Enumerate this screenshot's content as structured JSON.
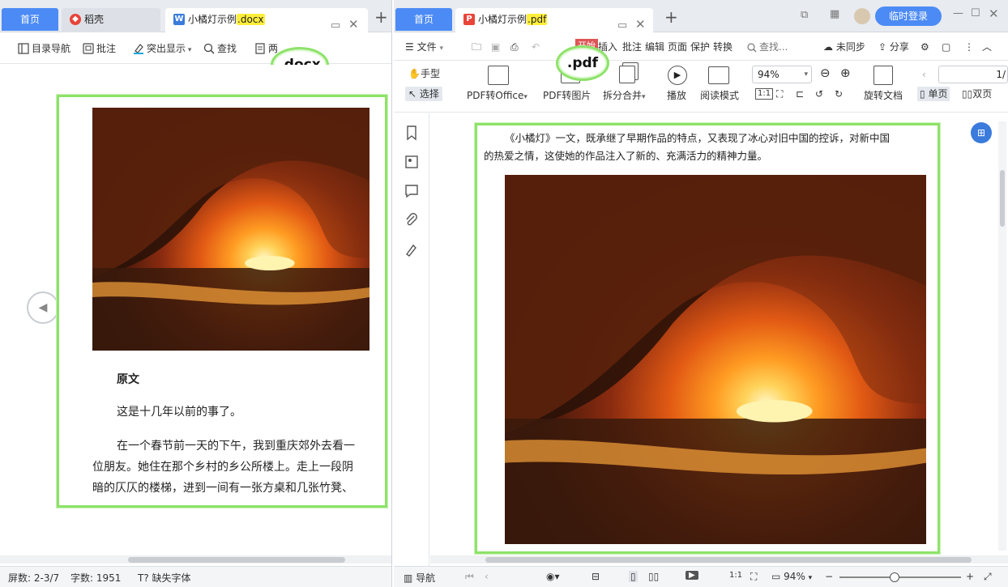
{
  "left": {
    "tabs": {
      "home": "首页",
      "daoke": "稻壳",
      "doc_name": "小橘灯示例",
      "doc_ext": ".docx"
    },
    "toolbar": {
      "nav": "目录导航",
      "comment": "批注",
      "highlight": "突出显示",
      "find": "查找",
      "more": "两"
    },
    "callout": ".docx",
    "doc": {
      "heading": "原文",
      "p1": "这是十几年以前的事了。",
      "p2_l1": "在一个春节前一天的下午，我到重庆郊外去看一",
      "p2_l2": "位朋友。她住在那个乡村的乡公所楼上。走上一段阴",
      "p2_l3": "暗的仄仄的楼梯，进到一间有一张方桌和几张竹凳、"
    },
    "status": {
      "screen": "屏数: 2-3/7",
      "words": "字数: 1951",
      "missing_font": "缺失字体"
    }
  },
  "right": {
    "tabs": {
      "home": "首页",
      "doc_name": "小橘灯示例",
      "doc_ext": ".pdf",
      "login": "临时登录"
    },
    "menu": {
      "file": "文件",
      "start": "开始",
      "insert": "插入",
      "comment": "批注",
      "edit": "编辑",
      "page": "页面",
      "protect": "保护",
      "convert": "转换",
      "search": "查找...",
      "unsynced": "未同步",
      "share": "分享"
    },
    "ribbon": {
      "hand": "手型",
      "select": "选择",
      "to_office": "PDF转Office",
      "to_image": "PDF转图片",
      "split_merge": "拆分合并",
      "play": "播放",
      "read_mode": "阅读模式",
      "zoom": "94%",
      "rotate_doc": "旋转文档",
      "page_num": "1/",
      "single": "单页",
      "double": "双页"
    },
    "callout": ".pdf",
    "doc": {
      "line1": "《小橘灯》一文，既承继了早期作品的特点，又表现了冰心对旧中国的控诉，对新中国",
      "line2": "的热爱之情，这使她的作品注入了新的、充满活力的精神力量。"
    },
    "status": {
      "nav": "导航",
      "zoom": "94%"
    }
  },
  "colors": {
    "accent": "#4c8bf5",
    "highlight": "#ffef3a",
    "frame": "#8ee26a"
  }
}
